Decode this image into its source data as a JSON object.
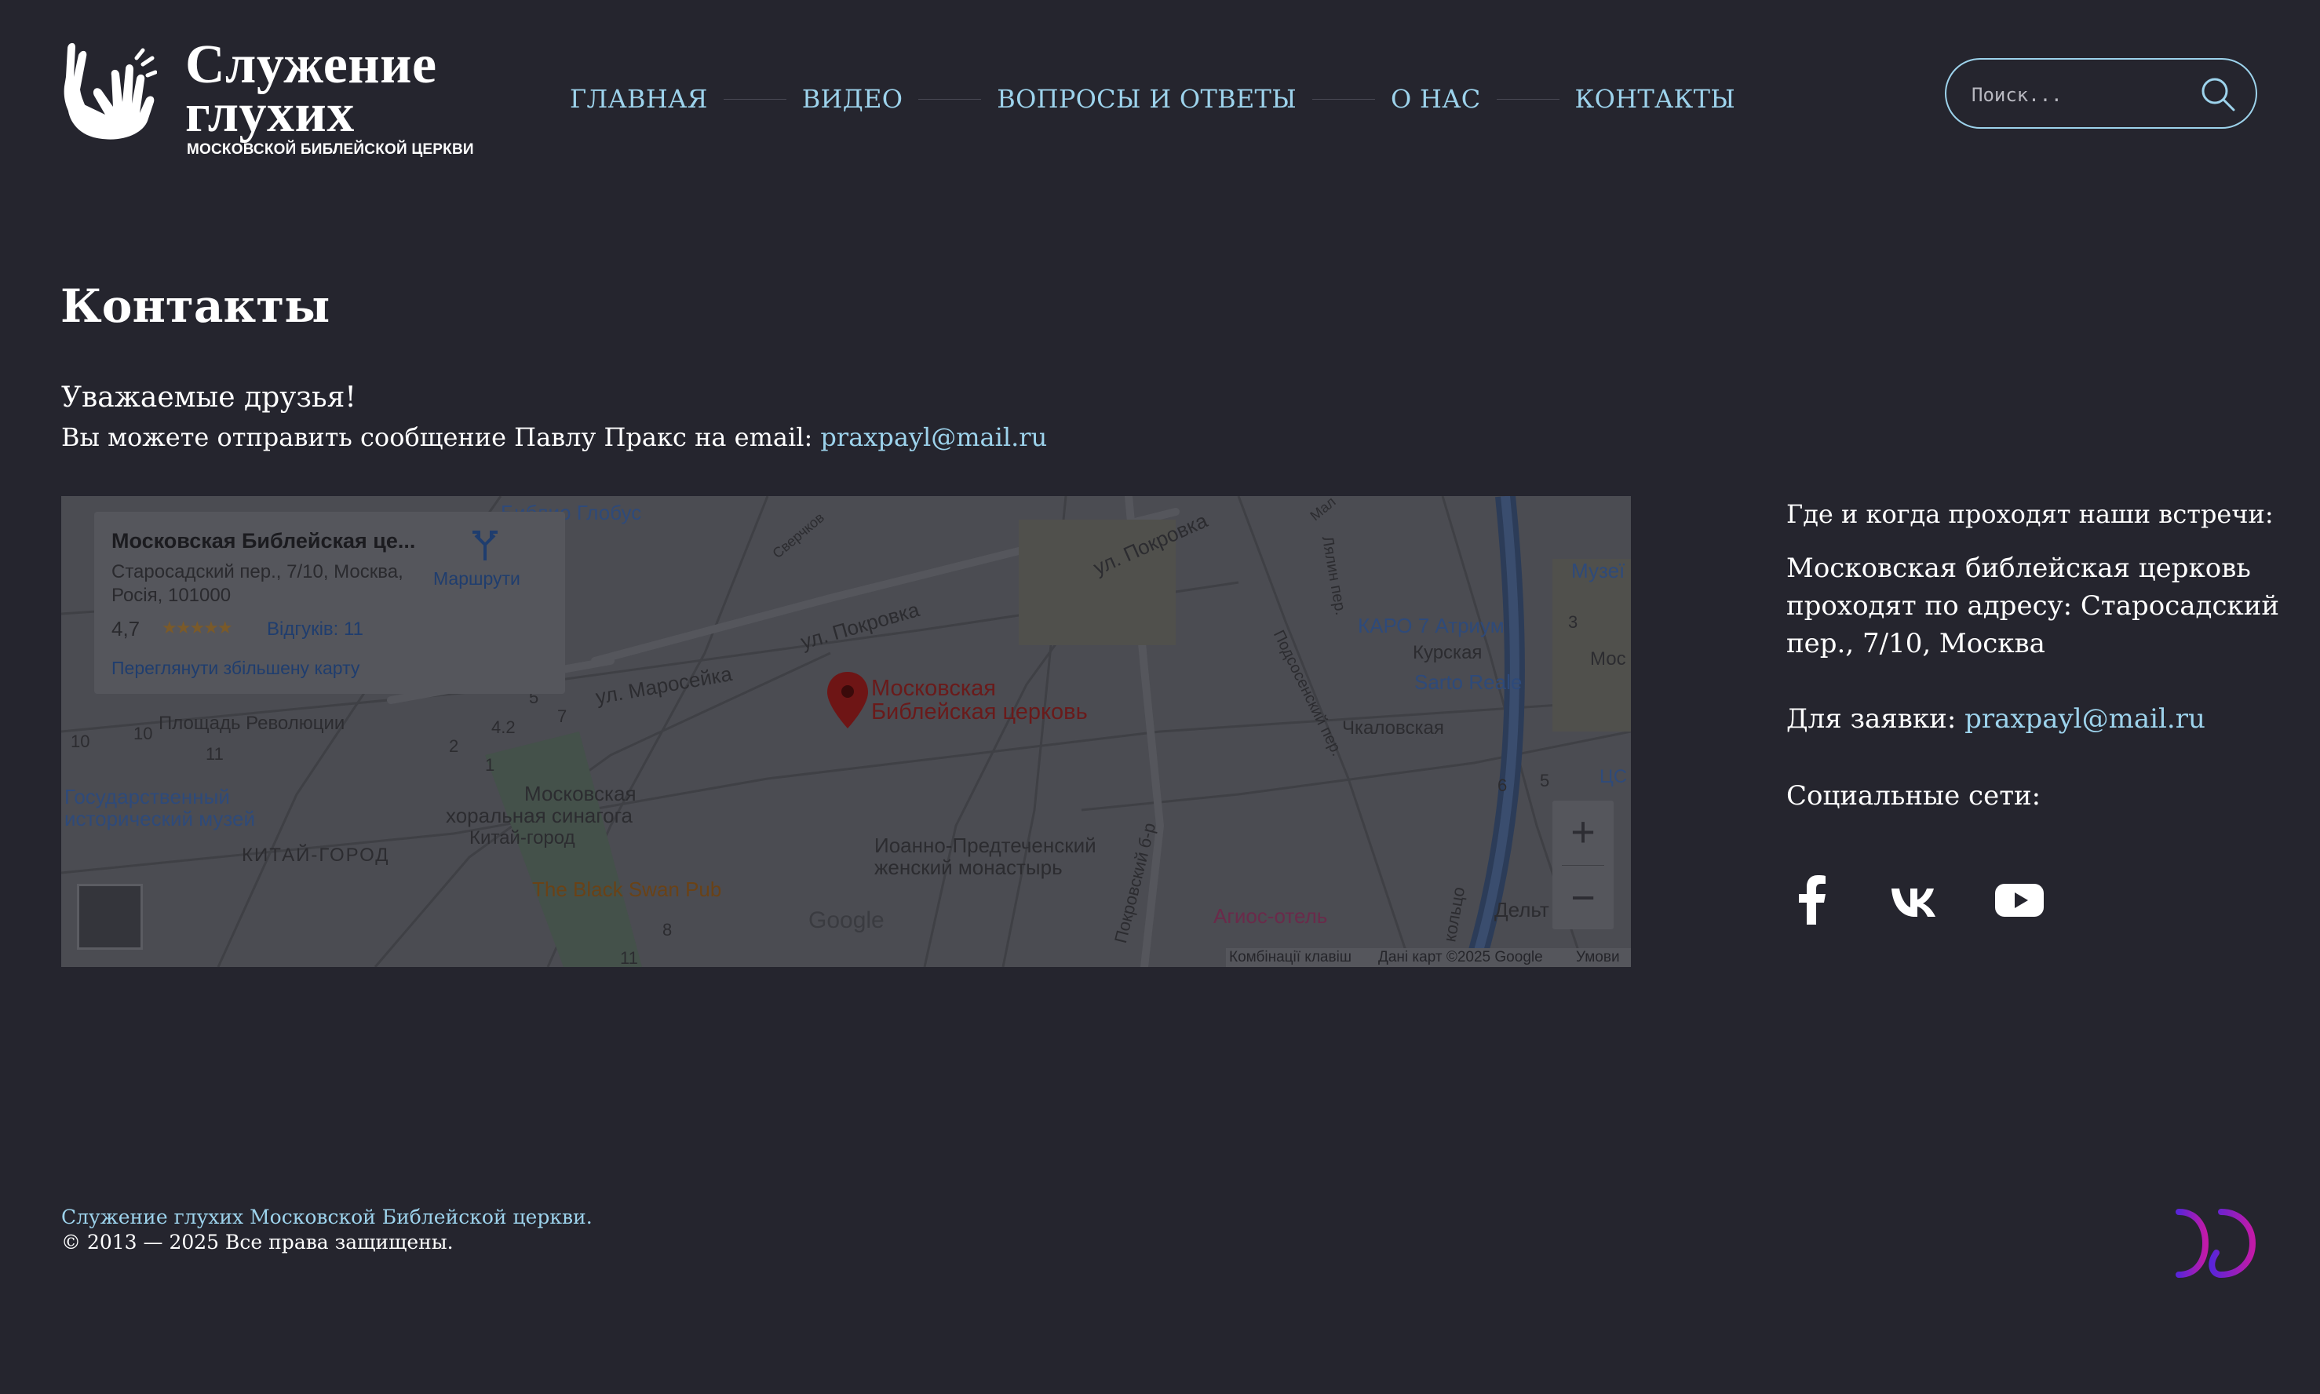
{
  "site": {
    "logo_title_line1": "Служение",
    "logo_title_line2": "глухих",
    "logo_subtitle": "МОСКОВСКОЙ БИБЛЕЙСКОЙ ЦЕРКВИ"
  },
  "nav": {
    "items": [
      {
        "label": "ГЛАВНАЯ"
      },
      {
        "label": "ВИДЕО"
      },
      {
        "label": "ВОПРОСЫ И ОТВЕТЫ"
      },
      {
        "label": "О НАС"
      },
      {
        "label": "КОНТАКТЫ"
      }
    ]
  },
  "search": {
    "placeholder": "Поиск..."
  },
  "page": {
    "title": "Контакты",
    "greeting": "Уважаемые друзья!",
    "intro_text": "Вы можете отправить сообщение Павлу Пракс на email: ",
    "intro_email": "praxpayl@mail.ru"
  },
  "map": {
    "card_title": "Московская Библейская це...",
    "card_address": "Старосадский пер., 7/10, Москва, Росія, 101000",
    "card_rating": "4,7",
    "card_stars": "★★★★★",
    "card_reviews": "Відгуків: 11",
    "card_enlarge": "Переглянути збільшену карту",
    "card_routes": "Маршрути",
    "pin_label_1": "Московская",
    "pin_label_2": "Библейская церковь",
    "labels": {
      "pokrovka_1": "ул. Покровка",
      "pokrovka_2": "ул. Покровка",
      "maroseyka": "ул. Маросейка",
      "ploshchad": "Площадь Революции",
      "museum_1": "Государственный",
      "museum_2": "исторический музей",
      "kitay_gorod": "КИТАЙ-ГОРОД",
      "synagogue_1": "Московская",
      "synagogue_2": "хоральная синагога",
      "kitay_gorod_metro": "Китай-город",
      "black_swan": "The Black Swan Pub",
      "monastery_1": "Иоанно-Предтеченский",
      "monastery_2": "женский монастырь",
      "karo": "КАРО 7 Атриум",
      "kurskaya": "Курская",
      "sarto": "Sarto Reale",
      "chkalovskaya": "Чкаловская",
      "agios": "Агиос-отель",
      "podsosensky": "Подсосенский пер.",
      "lyalin": "Лялин пер.",
      "pokrovsky_b": "Покровский б-р",
      "koltso": "кольцо",
      "delta": "Дельт",
      "muz": "Музеї",
      "mos": "Мос",
      "tsc": "ЦС",
      "globus": "Библио Глобус",
      "sverchkov": "Сверчков",
      "mal": "Мал",
      "n10a": "10",
      "n10b": "10",
      "n11a": "11",
      "n11b": "11",
      "n5": "5",
      "n7": "7",
      "n4_2": "4.2",
      "n2": "2",
      "n1": "1",
      "n8": "8",
      "n3": "3",
      "n6": "6",
      "n5b": "5"
    },
    "google_logo": "Google",
    "attribution": {
      "shortcuts": "Комбінації клавіш",
      "data": "Дані карт ©2025 Google",
      "terms": "Умови"
    },
    "zoom_in": "+",
    "zoom_out": "−"
  },
  "sidebar": {
    "heading": "Где и когда проходят наши встречи:",
    "address_text": "Московская библейская церковь проходят по адресу: Старосадский пер., 7/10, Москва",
    "order_label": "Для заявки: ",
    "order_email": "praxpayl@mail.ru",
    "social_heading": "Социальные сети:",
    "socials": [
      "facebook-icon",
      "vk-icon",
      "youtube-icon"
    ]
  },
  "footer": {
    "line1": "Служение глухих Московской Библейской церкви.",
    "line2": "© 2013 — 2025 Все права защищены."
  },
  "colors": {
    "background": "#25252e",
    "link": "#9dd3ec",
    "text": "#ffffff",
    "dev_logo": "#8a1fd6"
  }
}
